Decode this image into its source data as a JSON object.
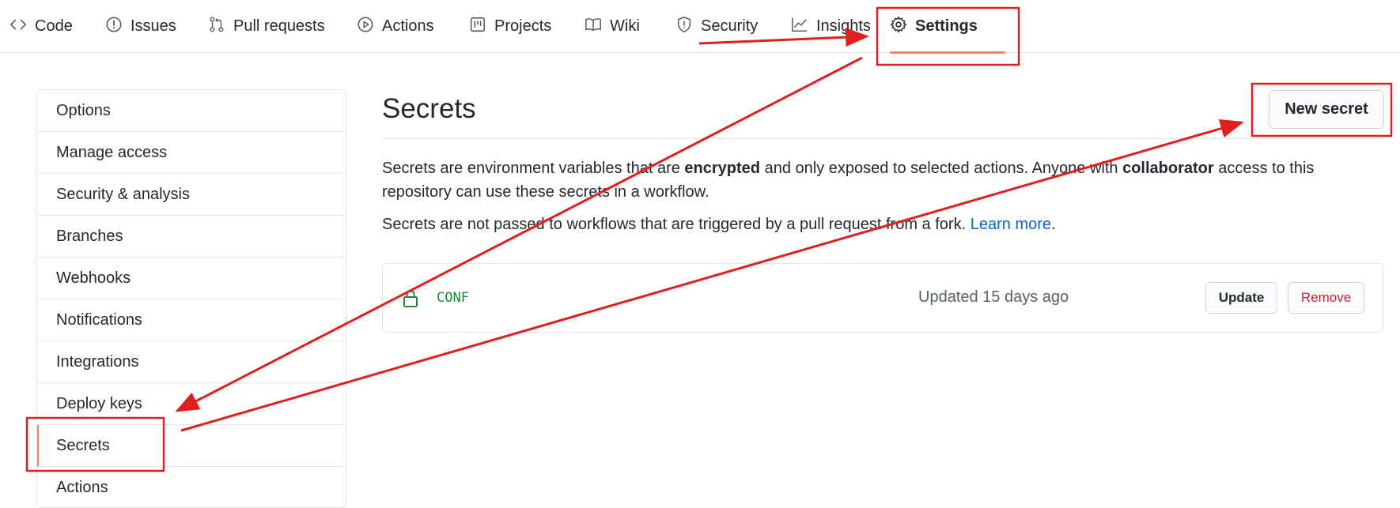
{
  "repo_nav": {
    "tabs": [
      {
        "label": "Code",
        "icon": "code-icon"
      },
      {
        "label": "Issues",
        "icon": "issue-icon"
      },
      {
        "label": "Pull requests",
        "icon": "pull-request-icon"
      },
      {
        "label": "Actions",
        "icon": "play-icon"
      },
      {
        "label": "Projects",
        "icon": "project-icon"
      },
      {
        "label": "Wiki",
        "icon": "book-icon"
      },
      {
        "label": "Security",
        "icon": "shield-icon"
      },
      {
        "label": "Insights",
        "icon": "graph-icon"
      },
      {
        "label": "Settings",
        "icon": "gear-icon",
        "selected": true
      }
    ]
  },
  "sidebar": {
    "items": [
      {
        "label": "Options"
      },
      {
        "label": "Manage access"
      },
      {
        "label": "Security & analysis"
      },
      {
        "label": "Branches"
      },
      {
        "label": "Webhooks"
      },
      {
        "label": "Notifications"
      },
      {
        "label": "Integrations"
      },
      {
        "label": "Deploy keys"
      },
      {
        "label": "Secrets",
        "selected": true
      },
      {
        "label": "Actions"
      }
    ]
  },
  "main": {
    "title": "Secrets",
    "new_secret_label": "New secret",
    "desc1": {
      "part1": "Secrets are environment variables that are ",
      "bold1": "encrypted",
      "part2": " and only exposed to selected actions. Anyone with ",
      "bold2": "collaborator",
      "part3": " access to this repository can use these secrets in a workflow."
    },
    "desc2": {
      "text": "Secrets are not passed to workflows that are triggered by a pull request from a fork. ",
      "link": "Learn more",
      "end": "."
    },
    "secrets": [
      {
        "name": "CONF",
        "updated": "Updated 15 days ago",
        "update_label": "Update",
        "remove_label": "Remove"
      }
    ]
  },
  "colors": {
    "accent_underline": "#f9826c",
    "annotation_red": "#e02020",
    "secret_name_green": "#22863a",
    "link_blue": "#0366d6",
    "danger_red": "#cb2431"
  }
}
